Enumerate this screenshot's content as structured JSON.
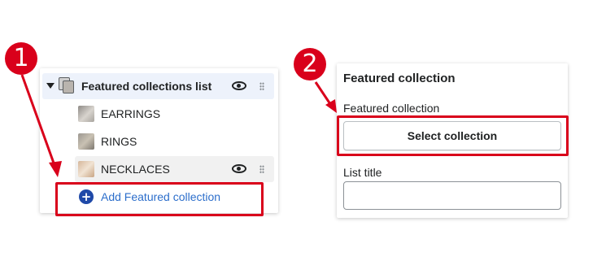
{
  "steps": {
    "first": "1",
    "second": "2"
  },
  "colors": {
    "annotation": "#d9001b",
    "link": "#2c6ecb",
    "selected_row": "#edf2fb"
  },
  "left_panel": {
    "header": {
      "title": "Featured collections list",
      "expanded": true,
      "visible": true
    },
    "items": [
      {
        "label": "EARRINGS"
      },
      {
        "label": "RINGS"
      },
      {
        "label": "NECKLACES",
        "hovered": true,
        "visible": true
      }
    ],
    "add_button": {
      "label": "Add Featured collection",
      "icon": "plus-circle-icon"
    }
  },
  "right_panel": {
    "title": "Featured collection",
    "collection_field": {
      "label": "Featured collection",
      "button_label": "Select collection"
    },
    "list_title_field": {
      "label": "List title",
      "value": ""
    }
  }
}
